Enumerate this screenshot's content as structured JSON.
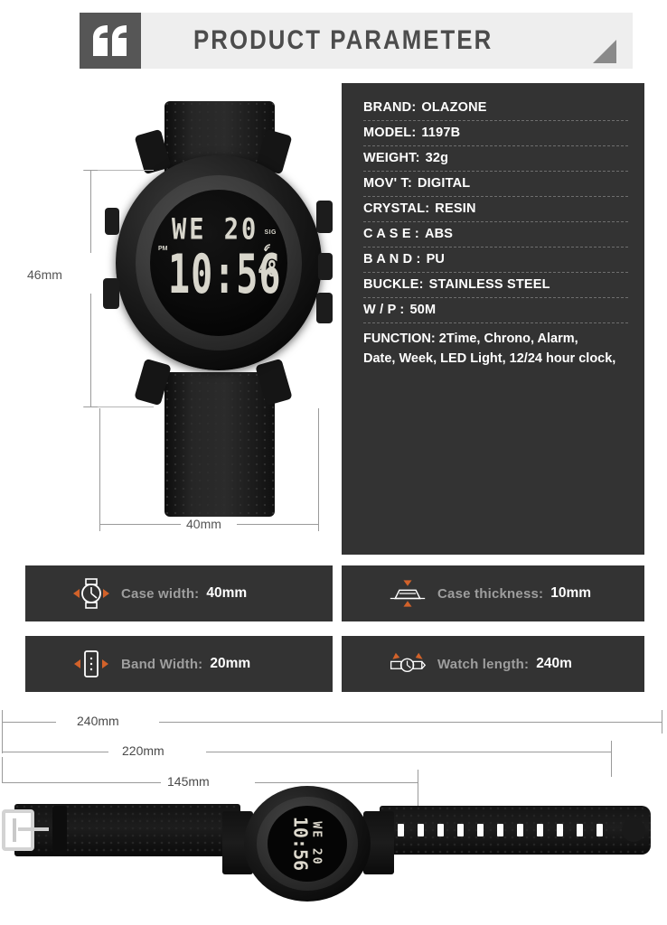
{
  "header": {
    "title": "PRODUCT PARAMETER",
    "quote_icon": "quote-mark-icon",
    "triangle_icon": "corner-triangle-icon"
  },
  "specs": {
    "rows": [
      {
        "key": "BRAND:",
        "value": "OLAZONE"
      },
      {
        "key": "MODEL:",
        "value": "1197B"
      },
      {
        "key": "WEIGHT:",
        "value": "32g"
      },
      {
        "key": "MOV' T:",
        "value": "DIGITAL"
      },
      {
        "key": "CRYSTAL:",
        "value": "RESIN"
      },
      {
        "key": "C A S E :",
        "value": "ABS"
      },
      {
        "key": "B A N D :",
        "value": "PU"
      },
      {
        "key": "BUCKLE:",
        "value": "STAINLESS STEEL"
      },
      {
        "key": "W / P :",
        "value": "50M"
      }
    ],
    "function": {
      "key": "FUNCTION:",
      "line1": "2Time, Chrono, Alarm,",
      "line2": "Date, Week, LED Light, 12/24 hour clock,"
    }
  },
  "watch_front": {
    "lcd": {
      "day": "WE",
      "date": "20",
      "signal": "SIG",
      "meridiem": "PM",
      "time": "10:56",
      "seconds": "48"
    },
    "dimensions": {
      "height": "46mm",
      "width": "40mm"
    }
  },
  "features": [
    {
      "icon": "watch-case-width-icon",
      "label": "Case width:",
      "value": "40mm"
    },
    {
      "icon": "watch-case-thickness-icon",
      "label": "Case thickness:",
      "value": "10mm"
    },
    {
      "icon": "watch-band-width-icon",
      "label": "Band Width:",
      "value": "20mm"
    },
    {
      "icon": "watch-length-icon",
      "label": "Watch length:",
      "value": "240m"
    }
  ],
  "bottom_dimensions": [
    {
      "label": "240mm"
    },
    {
      "label": "220mm"
    },
    {
      "label": "145mm"
    }
  ],
  "watch_flat": {
    "lcd_line1": "WE 20",
    "lcd_line2": "10:56"
  },
  "colors": {
    "panel_bg": "#333333",
    "header_bar": "#eeeeee",
    "header_quote": "#565656",
    "accent_orange": "#d2622a",
    "label_gray": "#9e9e9e",
    "dim_line": "#9a9a9a"
  }
}
